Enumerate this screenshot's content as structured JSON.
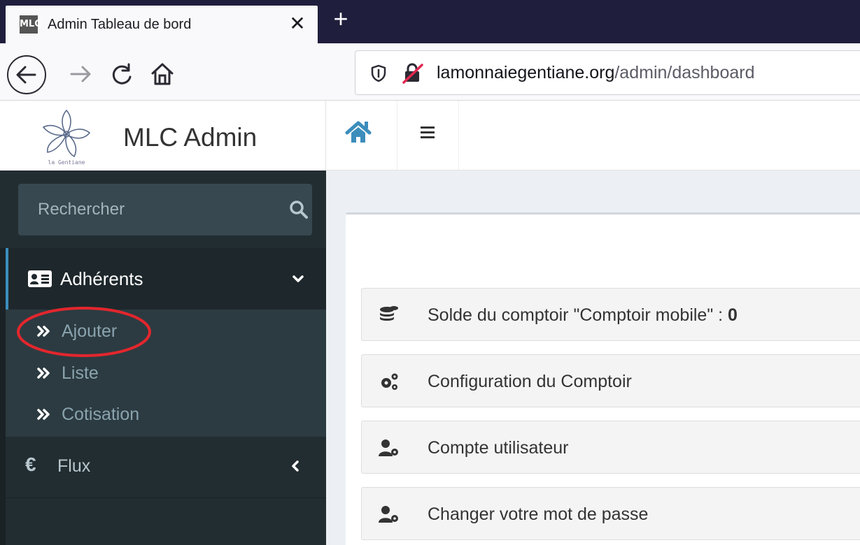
{
  "browser": {
    "tab_title": "Admin Tableau de bord",
    "favicon_text": "MLC",
    "close_glyph": "✕",
    "newtab_glyph": "+",
    "url_domain": "lamonnaiegentiane.org",
    "url_path": "/admin/dashboard"
  },
  "app": {
    "brand": "MLC Admin",
    "logo_caption": "la Gentiane"
  },
  "sidebar": {
    "search_placeholder": "Rechercher",
    "adherents_label": "Adhérents",
    "sub_items": [
      "Ajouter",
      "Liste",
      "Cotisation"
    ],
    "flux_label": "Flux",
    "flux_symbol": "€"
  },
  "main": {
    "items": [
      {
        "text": "Solde du comptoir \"Comptoir mobile\" : ",
        "value": "0",
        "icon": "coins-icon"
      },
      {
        "text": "Configuration du Comptoir",
        "icon": "cogs-icon"
      },
      {
        "text": "Compte utilisateur",
        "icon": "user-cog-icon"
      },
      {
        "text": "Changer votre mot de passe",
        "icon": "user-cog-icon"
      }
    ]
  },
  "colors": {
    "sidebar_bg": "#222d32",
    "accent": "#3c8dbc",
    "annotation": "#e3262d"
  }
}
